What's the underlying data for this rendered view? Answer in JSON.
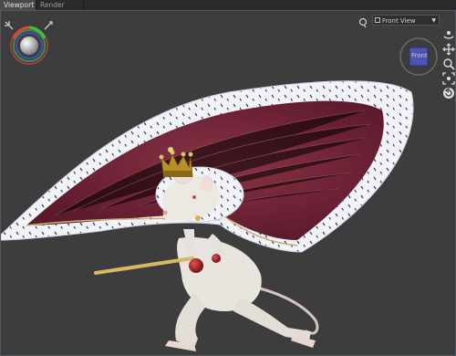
{
  "tabs": [
    {
      "label": "Viewport",
      "active": true
    },
    {
      "label": "Render Library",
      "active": false
    }
  ],
  "view_menu": {
    "selected": "Front View"
  },
  "view_cube": {
    "label": "Front"
  },
  "colors": {
    "background": "#3d3d3d",
    "tab_active": "#4a4a4a",
    "tab_inactive": "#2a2a2a",
    "cube_face": "#4d55b0",
    "cape_fur": "#f2f3f8",
    "cape_velvet": "#7a2a40",
    "crown_gold": "#b89028"
  },
  "icons": {
    "top_left": [
      "light-pointer-icon",
      "camera-ring-icon"
    ],
    "top_right": [
      "lamp-icon"
    ],
    "right_toolbar": [
      "orbit-icon",
      "pan-icon",
      "zoom-icon",
      "frame-icon",
      "reset-view-icon"
    ]
  }
}
